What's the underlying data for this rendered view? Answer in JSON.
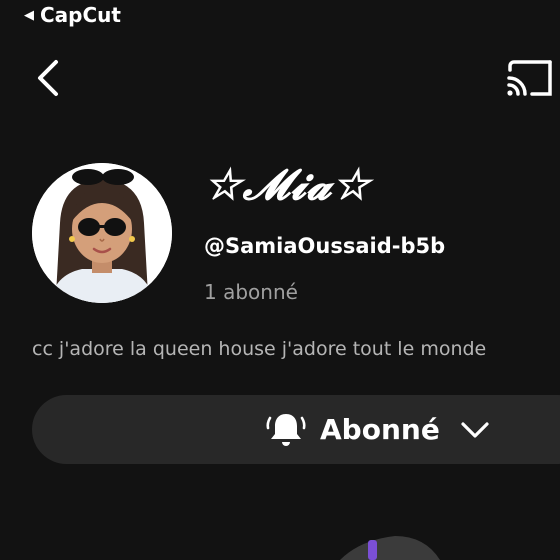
{
  "status_bar": {
    "back_app_label": "CapCut"
  },
  "profile": {
    "display_name": "☆𝓜𝓲𝓪☆",
    "username": "@SamiaOussaid-b5b",
    "followers": "1 abonné",
    "bio": "cc j'adore la queen house j'adore tout le monde"
  },
  "actions": {
    "subscribe_label": "Abonné"
  },
  "icons": {
    "back": "chevron-left-icon",
    "cast": "cast-icon",
    "bell": "bell-icon",
    "dropdown": "chevron-down-icon"
  },
  "colors": {
    "background": "#121212",
    "button_bg": "#282828",
    "secondary_text": "#a0a0a0",
    "accent": "#7b4fd6"
  }
}
